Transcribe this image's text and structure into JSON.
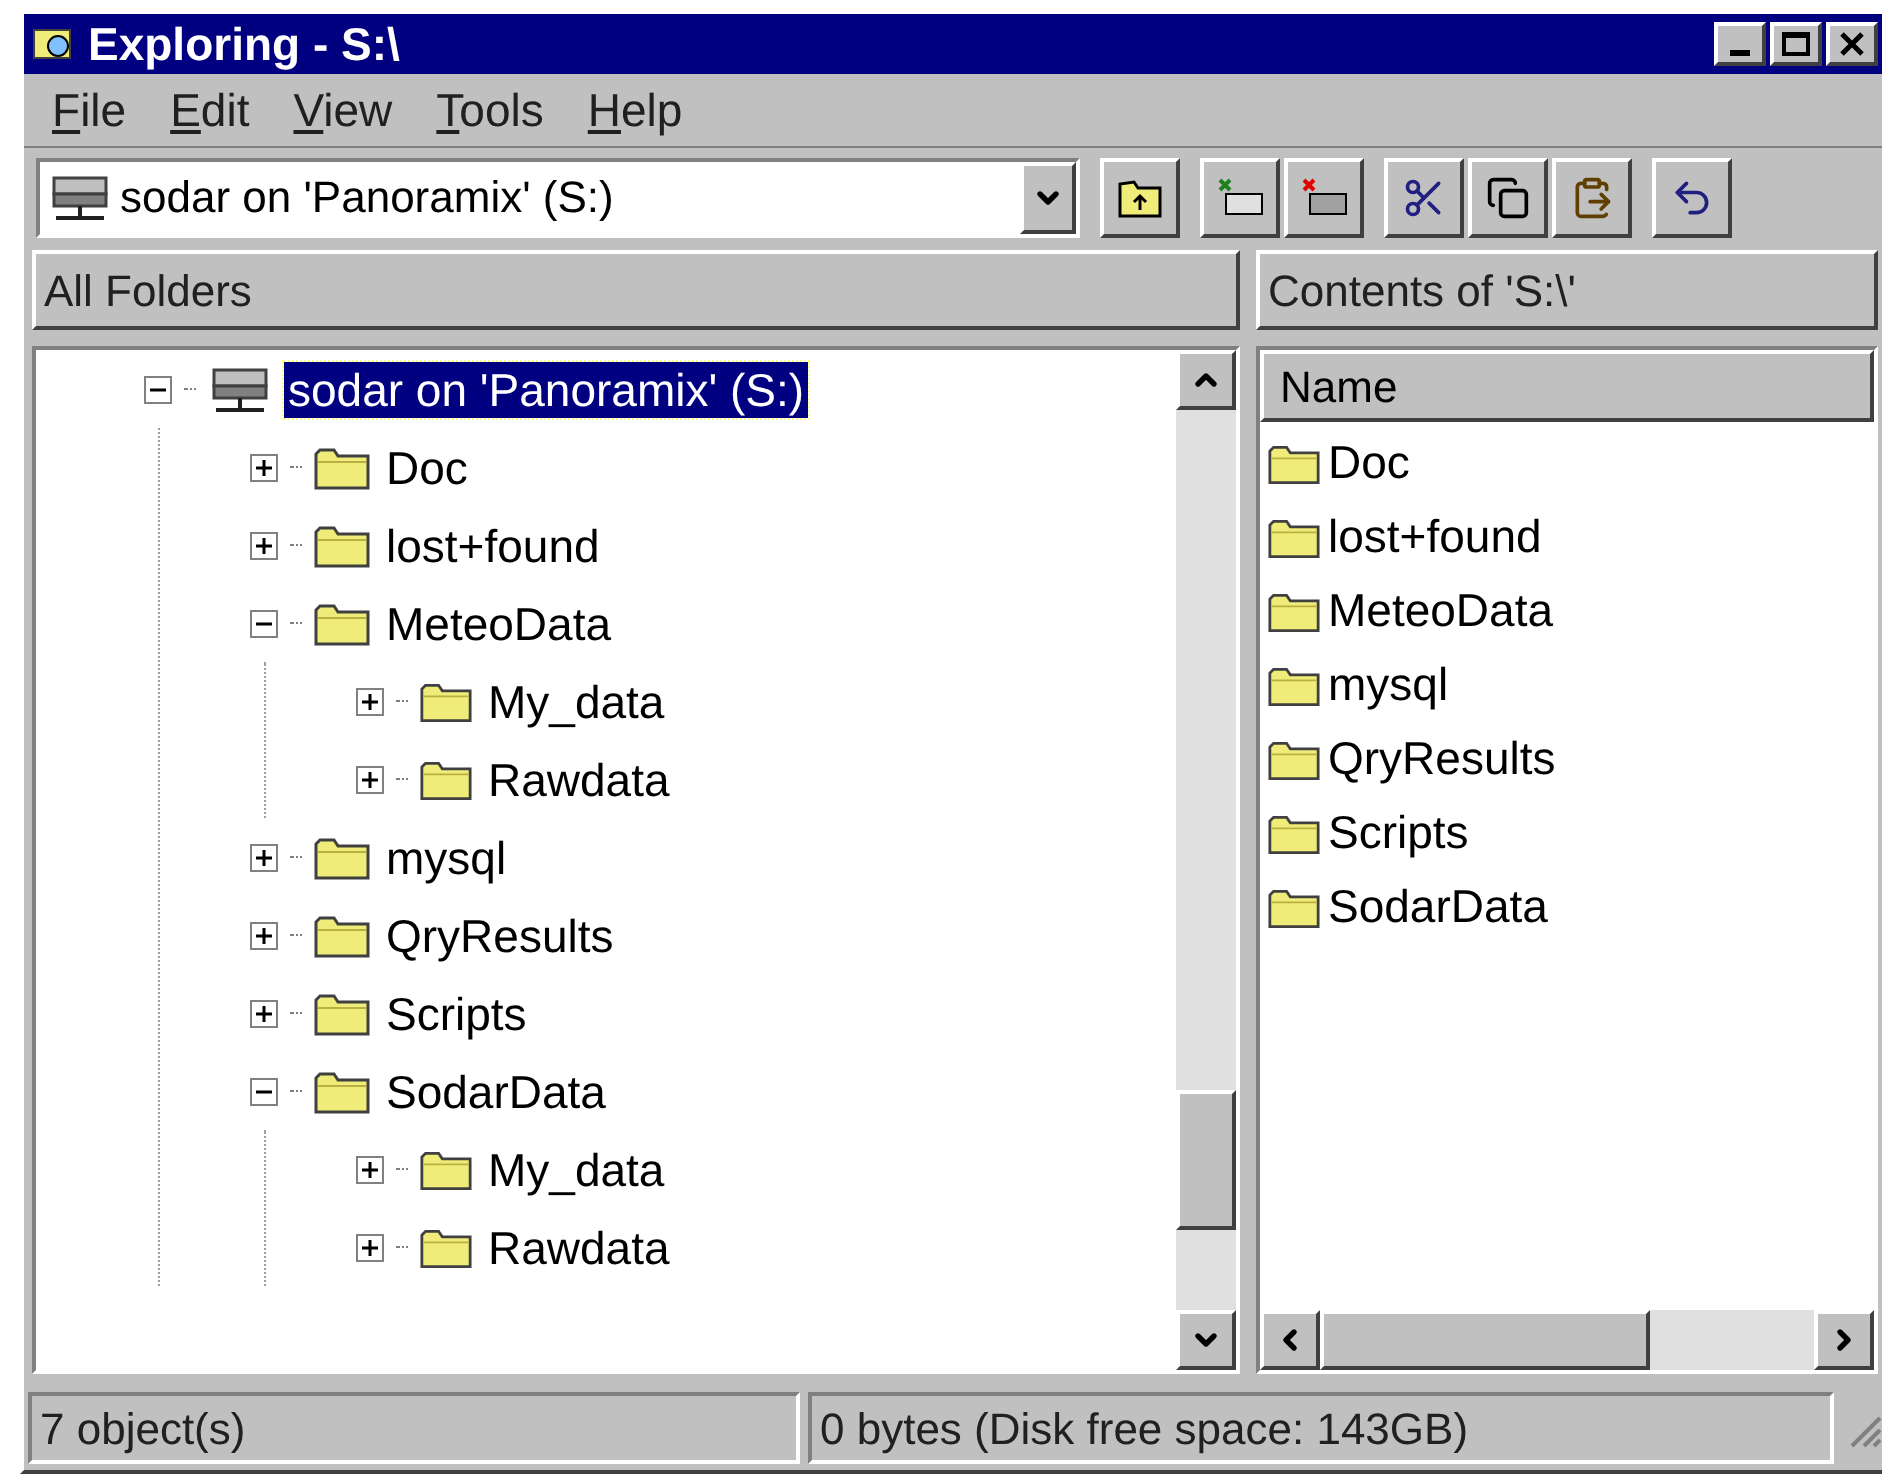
{
  "window": {
    "title": "Exploring - S:\\"
  },
  "menu": [
    "File",
    "Edit",
    "View",
    "Tools",
    "Help"
  ],
  "address": {
    "value": "sodar on 'Panoramix' (S:)"
  },
  "panes": {
    "left_title": "All Folders",
    "right_title": "Contents of 'S:\\'"
  },
  "tree": {
    "label": "sodar on 'Panoramix' (S:)",
    "kind": "drive",
    "expanded": true,
    "selected": true,
    "children": [
      {
        "label": "Doc",
        "expanded": false,
        "selected": false
      },
      {
        "label": "lost+found",
        "expanded": false,
        "selected": false
      },
      {
        "label": "MeteoData",
        "expanded": true,
        "selected": false,
        "children": [
          {
            "label": "My_data",
            "expanded": false,
            "selected": false
          },
          {
            "label": "Rawdata",
            "expanded": false,
            "selected": false
          }
        ]
      },
      {
        "label": "mysql",
        "expanded": false,
        "selected": false
      },
      {
        "label": "QryResults",
        "expanded": false,
        "selected": false
      },
      {
        "label": "Scripts",
        "expanded": false,
        "selected": false
      },
      {
        "label": "SodarData",
        "expanded": true,
        "selected": false,
        "children": [
          {
            "label": "My_data",
            "expanded": false,
            "selected": false
          },
          {
            "label": "Rawdata",
            "expanded": false,
            "selected": false
          }
        ]
      }
    ]
  },
  "list": {
    "columns": [
      "Name"
    ],
    "items": [
      "Doc",
      "lost+found",
      "MeteoData",
      "mysql",
      "QryResults",
      "Scripts",
      "SodarData"
    ]
  },
  "status_bar": [
    "7 object(s)",
    "0 bytes (Disk free space: 143GB)"
  ]
}
